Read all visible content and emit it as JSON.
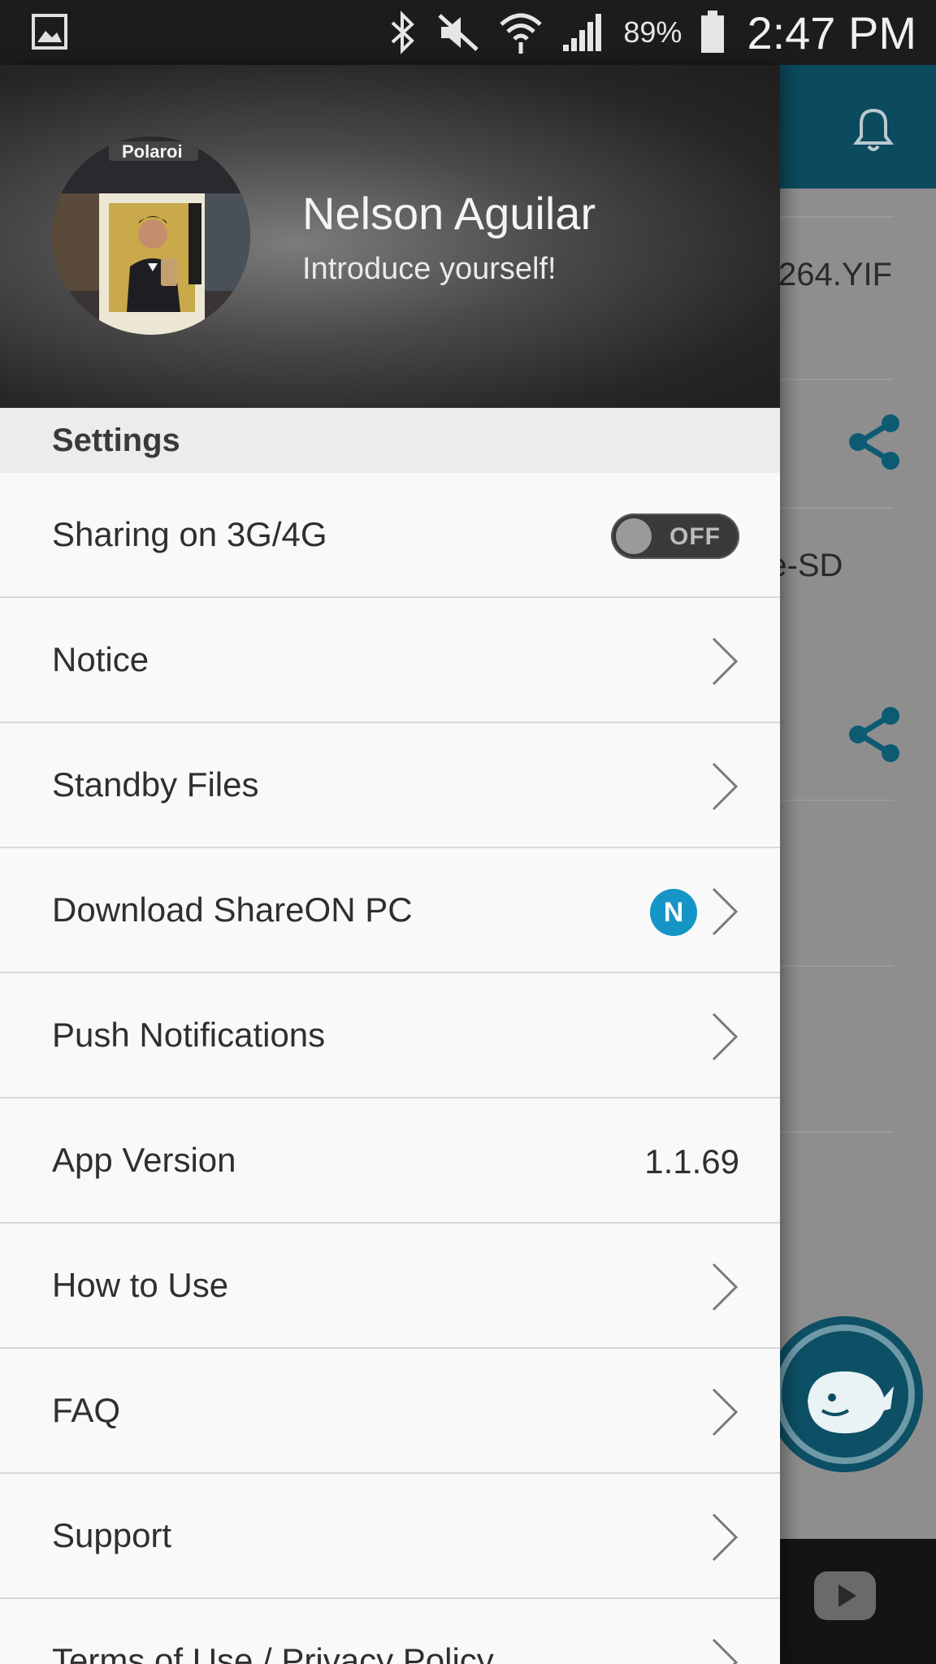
{
  "status_bar": {
    "battery_percent": "89%",
    "time": "2:47 PM",
    "icons": [
      "gallery-icon",
      "bluetooth-icon",
      "mute-icon",
      "wifi-icon",
      "signal-icon",
      "battery-icon"
    ]
  },
  "background_app": {
    "item1_text": "264.YIF",
    "item2_text": "ne-SD",
    "accent_color": "#0d5b73"
  },
  "profile": {
    "name": "Nelson Aguilar",
    "tagline": "Introduce yourself!"
  },
  "settings": {
    "section_title": "Settings",
    "items": [
      {
        "label": "Sharing on 3G/4G",
        "type": "toggle",
        "toggle_state": "OFF"
      },
      {
        "label": "Notice",
        "type": "link"
      },
      {
        "label": "Standby Files",
        "type": "link"
      },
      {
        "label": "Download ShareON PC",
        "type": "link",
        "badge": "N"
      },
      {
        "label": "Push Notifications",
        "type": "link"
      },
      {
        "label": "App Version",
        "type": "value",
        "value": "1.1.69"
      },
      {
        "label": "How to Use",
        "type": "link"
      },
      {
        "label": "FAQ",
        "type": "link"
      },
      {
        "label": "Support",
        "type": "link"
      },
      {
        "label": "Terms of Use / Privacy Policy",
        "type": "link"
      }
    ]
  }
}
